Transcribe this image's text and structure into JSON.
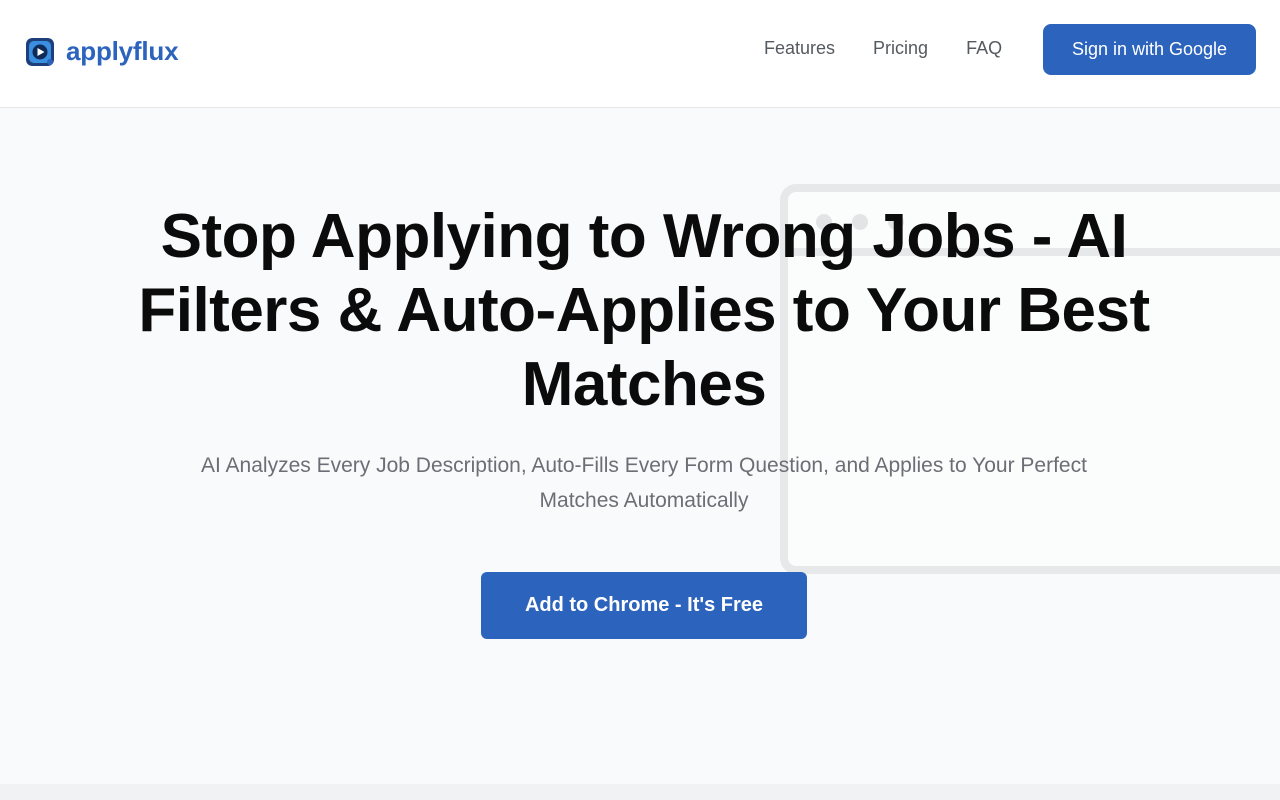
{
  "brand": {
    "name": "applyflux",
    "accent_color": "#2c63bd",
    "logo_icon": "play-gear-logo-icon"
  },
  "nav": {
    "items": [
      {
        "label": "Features"
      },
      {
        "label": "Pricing"
      },
      {
        "label": "FAQ"
      }
    ],
    "signin_label": "Sign in with Google"
  },
  "hero": {
    "headline": "Stop Applying to Wrong Jobs - AI Filters & Auto-Applies to Your Best Matches",
    "subheadline": "AI Analyzes Every Job Description, Auto-Fills Every Form Question, and Applies to Your Perfect Matches Automatically",
    "cta_label": "Add to Chrome - It's Free"
  }
}
